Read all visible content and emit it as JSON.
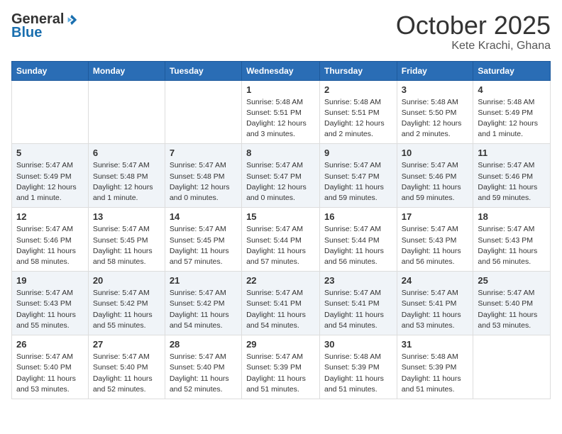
{
  "logo": {
    "general": "General",
    "blue": "Blue"
  },
  "header": {
    "month": "October 2025",
    "location": "Kete Krachi, Ghana"
  },
  "weekdays": [
    "Sunday",
    "Monday",
    "Tuesday",
    "Wednesday",
    "Thursday",
    "Friday",
    "Saturday"
  ],
  "weeks": [
    [
      {
        "day": "",
        "info": ""
      },
      {
        "day": "",
        "info": ""
      },
      {
        "day": "",
        "info": ""
      },
      {
        "day": "1",
        "info": "Sunrise: 5:48 AM\nSunset: 5:51 PM\nDaylight: 12 hours\nand 3 minutes."
      },
      {
        "day": "2",
        "info": "Sunrise: 5:48 AM\nSunset: 5:51 PM\nDaylight: 12 hours\nand 2 minutes."
      },
      {
        "day": "3",
        "info": "Sunrise: 5:48 AM\nSunset: 5:50 PM\nDaylight: 12 hours\nand 2 minutes."
      },
      {
        "day": "4",
        "info": "Sunrise: 5:48 AM\nSunset: 5:49 PM\nDaylight: 12 hours\nand 1 minute."
      }
    ],
    [
      {
        "day": "5",
        "info": "Sunrise: 5:47 AM\nSunset: 5:49 PM\nDaylight: 12 hours\nand 1 minute."
      },
      {
        "day": "6",
        "info": "Sunrise: 5:47 AM\nSunset: 5:48 PM\nDaylight: 12 hours\nand 1 minute."
      },
      {
        "day": "7",
        "info": "Sunrise: 5:47 AM\nSunset: 5:48 PM\nDaylight: 12 hours\nand 0 minutes."
      },
      {
        "day": "8",
        "info": "Sunrise: 5:47 AM\nSunset: 5:47 PM\nDaylight: 12 hours\nand 0 minutes."
      },
      {
        "day": "9",
        "info": "Sunrise: 5:47 AM\nSunset: 5:47 PM\nDaylight: 11 hours\nand 59 minutes."
      },
      {
        "day": "10",
        "info": "Sunrise: 5:47 AM\nSunset: 5:46 PM\nDaylight: 11 hours\nand 59 minutes."
      },
      {
        "day": "11",
        "info": "Sunrise: 5:47 AM\nSunset: 5:46 PM\nDaylight: 11 hours\nand 59 minutes."
      }
    ],
    [
      {
        "day": "12",
        "info": "Sunrise: 5:47 AM\nSunset: 5:46 PM\nDaylight: 11 hours\nand 58 minutes."
      },
      {
        "day": "13",
        "info": "Sunrise: 5:47 AM\nSunset: 5:45 PM\nDaylight: 11 hours\nand 58 minutes."
      },
      {
        "day": "14",
        "info": "Sunrise: 5:47 AM\nSunset: 5:45 PM\nDaylight: 11 hours\nand 57 minutes."
      },
      {
        "day": "15",
        "info": "Sunrise: 5:47 AM\nSunset: 5:44 PM\nDaylight: 11 hours\nand 57 minutes."
      },
      {
        "day": "16",
        "info": "Sunrise: 5:47 AM\nSunset: 5:44 PM\nDaylight: 11 hours\nand 56 minutes."
      },
      {
        "day": "17",
        "info": "Sunrise: 5:47 AM\nSunset: 5:43 PM\nDaylight: 11 hours\nand 56 minutes."
      },
      {
        "day": "18",
        "info": "Sunrise: 5:47 AM\nSunset: 5:43 PM\nDaylight: 11 hours\nand 56 minutes."
      }
    ],
    [
      {
        "day": "19",
        "info": "Sunrise: 5:47 AM\nSunset: 5:43 PM\nDaylight: 11 hours\nand 55 minutes."
      },
      {
        "day": "20",
        "info": "Sunrise: 5:47 AM\nSunset: 5:42 PM\nDaylight: 11 hours\nand 55 minutes."
      },
      {
        "day": "21",
        "info": "Sunrise: 5:47 AM\nSunset: 5:42 PM\nDaylight: 11 hours\nand 54 minutes."
      },
      {
        "day": "22",
        "info": "Sunrise: 5:47 AM\nSunset: 5:41 PM\nDaylight: 11 hours\nand 54 minutes."
      },
      {
        "day": "23",
        "info": "Sunrise: 5:47 AM\nSunset: 5:41 PM\nDaylight: 11 hours\nand 54 minutes."
      },
      {
        "day": "24",
        "info": "Sunrise: 5:47 AM\nSunset: 5:41 PM\nDaylight: 11 hours\nand 53 minutes."
      },
      {
        "day": "25",
        "info": "Sunrise: 5:47 AM\nSunset: 5:40 PM\nDaylight: 11 hours\nand 53 minutes."
      }
    ],
    [
      {
        "day": "26",
        "info": "Sunrise: 5:47 AM\nSunset: 5:40 PM\nDaylight: 11 hours\nand 53 minutes."
      },
      {
        "day": "27",
        "info": "Sunrise: 5:47 AM\nSunset: 5:40 PM\nDaylight: 11 hours\nand 52 minutes."
      },
      {
        "day": "28",
        "info": "Sunrise: 5:47 AM\nSunset: 5:40 PM\nDaylight: 11 hours\nand 52 minutes."
      },
      {
        "day": "29",
        "info": "Sunrise: 5:47 AM\nSunset: 5:39 PM\nDaylight: 11 hours\nand 51 minutes."
      },
      {
        "day": "30",
        "info": "Sunrise: 5:48 AM\nSunset: 5:39 PM\nDaylight: 11 hours\nand 51 minutes."
      },
      {
        "day": "31",
        "info": "Sunrise: 5:48 AM\nSunset: 5:39 PM\nDaylight: 11 hours\nand 51 minutes."
      },
      {
        "day": "",
        "info": ""
      }
    ]
  ]
}
